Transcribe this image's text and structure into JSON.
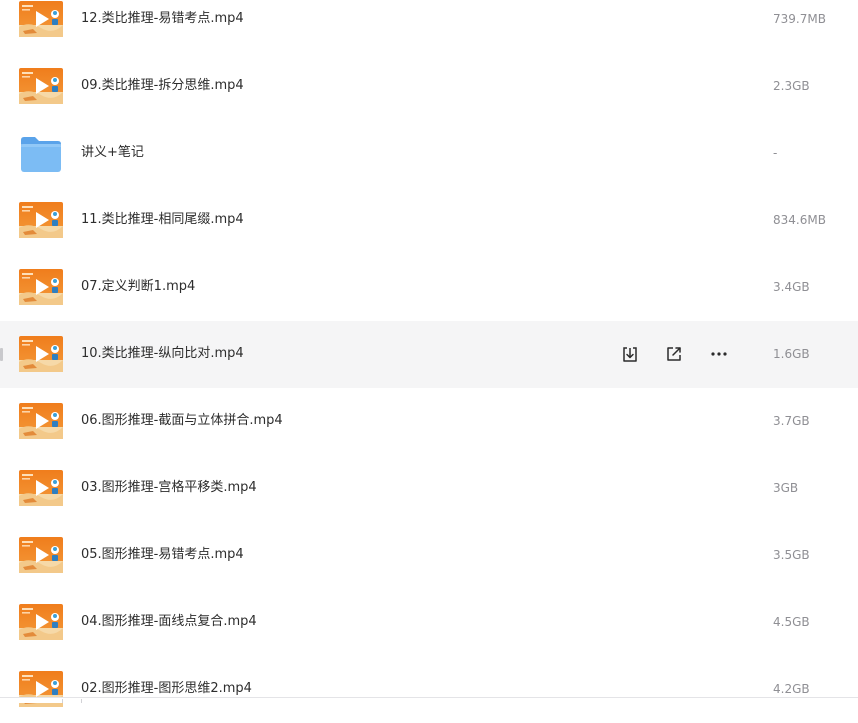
{
  "files": [
    {
      "name": "12.类比推理-易错考点.mp4",
      "size": "739.7MB",
      "type": "video"
    },
    {
      "name": "09.类比推理-拆分思维.mp4",
      "size": "2.3GB",
      "type": "video"
    },
    {
      "name": "讲义+笔记",
      "size": "-",
      "type": "folder"
    },
    {
      "name": "11.类比推理-相同尾缀.mp4",
      "size": "834.6MB",
      "type": "video"
    },
    {
      "name": "07.定义判断1.mp4",
      "size": "3.4GB",
      "type": "video"
    },
    {
      "name": "10.类比推理-纵向比对.mp4",
      "size": "1.6GB",
      "type": "video",
      "hovered": true
    },
    {
      "name": "06.图形推理-截面与立体拼合.mp4",
      "size": "3.7GB",
      "type": "video"
    },
    {
      "name": "03.图形推理-宫格平移类.mp4",
      "size": "3GB",
      "type": "video"
    },
    {
      "name": "05.图形推理-易错考点.mp4",
      "size": "3.5GB",
      "type": "video"
    },
    {
      "name": "04.图形推理-面线点复合.mp4",
      "size": "4.5GB",
      "type": "video"
    },
    {
      "name": "02.图形推理-图形思维2.mp4",
      "size": "4.2GB",
      "type": "video"
    }
  ],
  "row_actions": [
    "download-icon",
    "share-icon",
    "more-icon"
  ],
  "colors": {
    "hover_bg": "#f5f5f6",
    "name_text": "#2d2d2d",
    "size_text": "#8f8f94",
    "folder_blue": "#6fb2f2",
    "thumb_orange": "#ef7a1a"
  }
}
